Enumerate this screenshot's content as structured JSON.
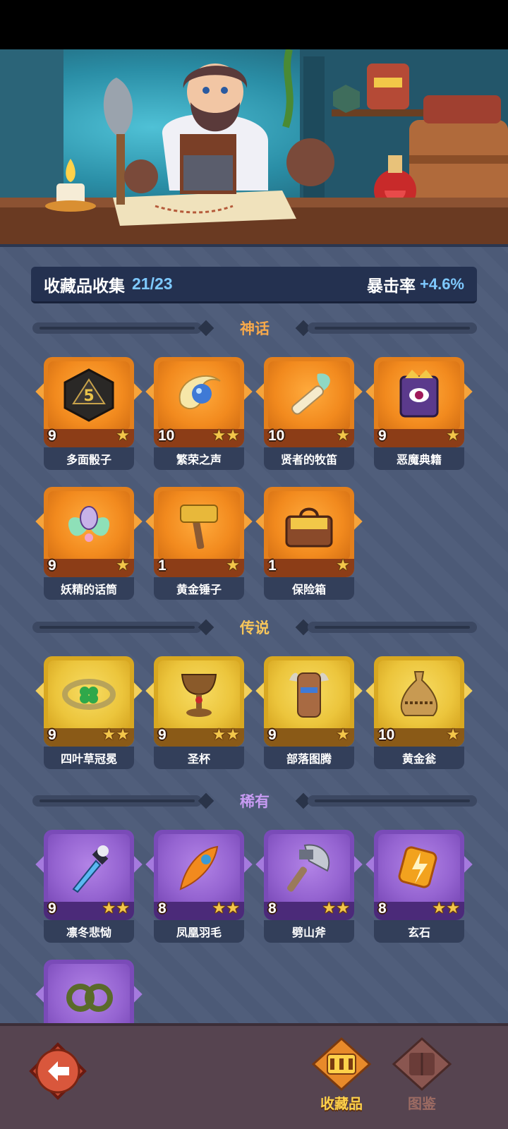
{
  "summary": {
    "label": "收藏品收集",
    "count": "21/23",
    "crit_label": "暴击率",
    "crit_value": "+4.6%"
  },
  "sections": {
    "mythic": {
      "title": "神话",
      "color": "#f7a94b"
    },
    "legendary": {
      "title": "传说",
      "color": "#f7c65a"
    },
    "rare": {
      "title": "稀有",
      "color": "#c79bf2"
    }
  },
  "items": {
    "mythic": [
      {
        "name": "多面骰子",
        "level": "9",
        "stars": 1,
        "icon": "d20-dice-icon"
      },
      {
        "name": "繁荣之声",
        "level": "10",
        "stars": 2,
        "icon": "conch-shell-icon"
      },
      {
        "name": "贤者的牧笛",
        "level": "10",
        "stars": 1,
        "icon": "flute-icon"
      },
      {
        "name": "恶魔典籍",
        "level": "9",
        "stars": 1,
        "icon": "demon-book-icon"
      },
      {
        "name": "妖精的话筒",
        "level": "9",
        "stars": 1,
        "icon": "fairy-megaphone-icon"
      },
      {
        "name": "黄金锤子",
        "level": "1",
        "stars": 1,
        "icon": "golden-hammer-icon"
      },
      {
        "name": "保险箱",
        "level": "1",
        "stars": 1,
        "icon": "treasure-chest-icon"
      }
    ],
    "legendary": [
      {
        "name": "四叶草冠冕",
        "level": "9",
        "stars": 2,
        "icon": "clover-crown-icon"
      },
      {
        "name": "圣杯",
        "level": "9",
        "stars": 2,
        "icon": "grail-icon"
      },
      {
        "name": "部落图腾",
        "level": "9",
        "stars": 1,
        "icon": "totem-icon"
      },
      {
        "name": "黄金瓮",
        "level": "10",
        "stars": 1,
        "icon": "golden-urn-icon"
      }
    ],
    "rare": [
      {
        "name": "凛冬悲恸",
        "level": "9",
        "stars": 2,
        "icon": "frost-sword-icon"
      },
      {
        "name": "凤凰羽毛",
        "level": "8",
        "stars": 2,
        "icon": "phoenix-feather-icon"
      },
      {
        "name": "劈山斧",
        "level": "8",
        "stars": 2,
        "icon": "axe-icon"
      },
      {
        "name": "玄石",
        "level": "8",
        "stars": 2,
        "icon": "lightning-stone-icon"
      }
    ]
  },
  "nav": {
    "collection_label": "收藏品",
    "codex_label": "图鉴"
  }
}
